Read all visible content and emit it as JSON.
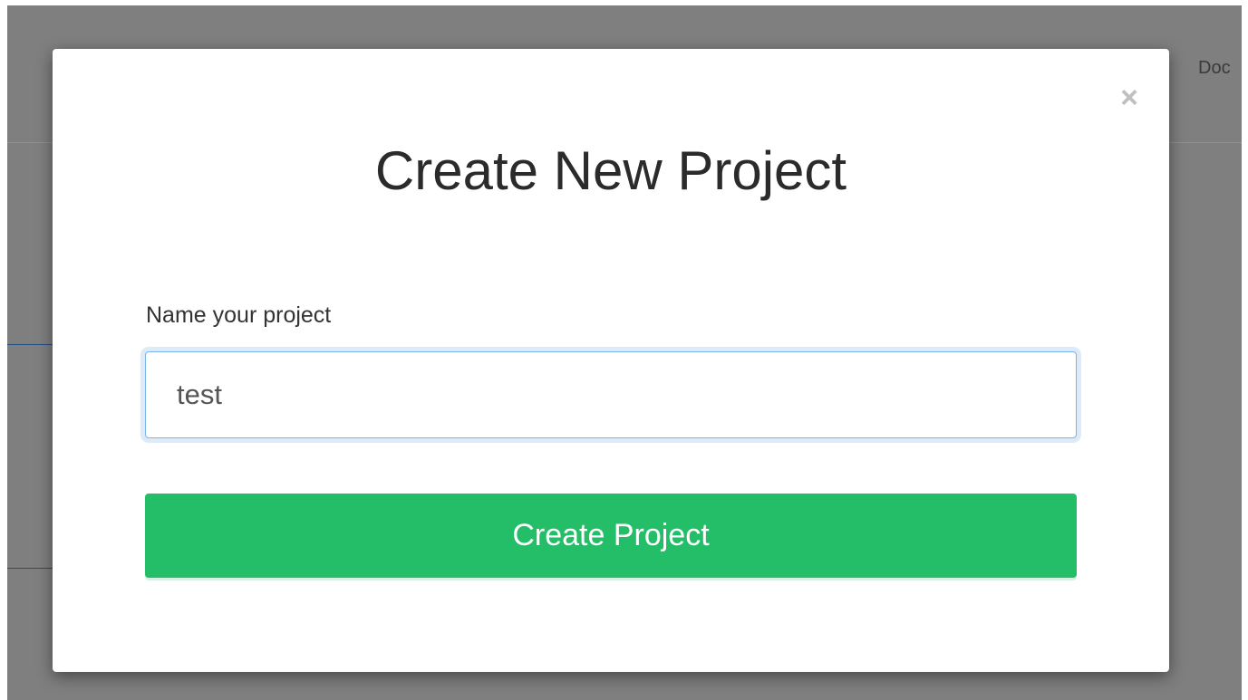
{
  "background": {
    "nav_text": "Doc"
  },
  "modal": {
    "close_symbol": "×",
    "title": "Create New Project",
    "name_label": "Name your project",
    "name_value": "test",
    "submit_label": "Create Project",
    "colors": {
      "submit_bg": "#24be68",
      "input_border": "#7cb3ea",
      "overlay": "rgba(0,0,0,0.5)"
    }
  }
}
